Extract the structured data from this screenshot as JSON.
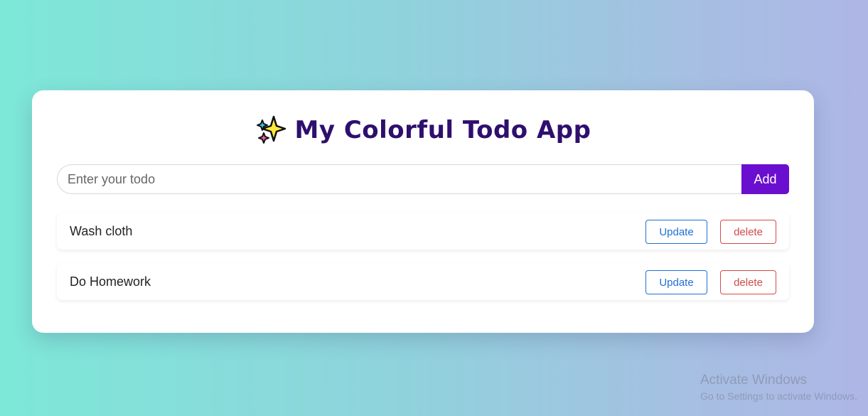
{
  "app": {
    "title": "My Colorful Todo App",
    "title_icon": "sparkles-icon",
    "colors": {
      "title": "#2e0f6e",
      "accent": "#6a0fcf",
      "update": "#1f6fd6",
      "delete": "#d24a4a"
    }
  },
  "input": {
    "placeholder": "Enter your todo",
    "value": "",
    "add_label": "Add"
  },
  "todos": [
    {
      "text": "Wash cloth",
      "update_label": "Update",
      "delete_label": "delete"
    },
    {
      "text": "Do Homework",
      "update_label": "Update",
      "delete_label": "delete"
    }
  ],
  "watermark": {
    "title": "Activate Windows",
    "subtitle": "Go to Settings to activate Windows."
  }
}
